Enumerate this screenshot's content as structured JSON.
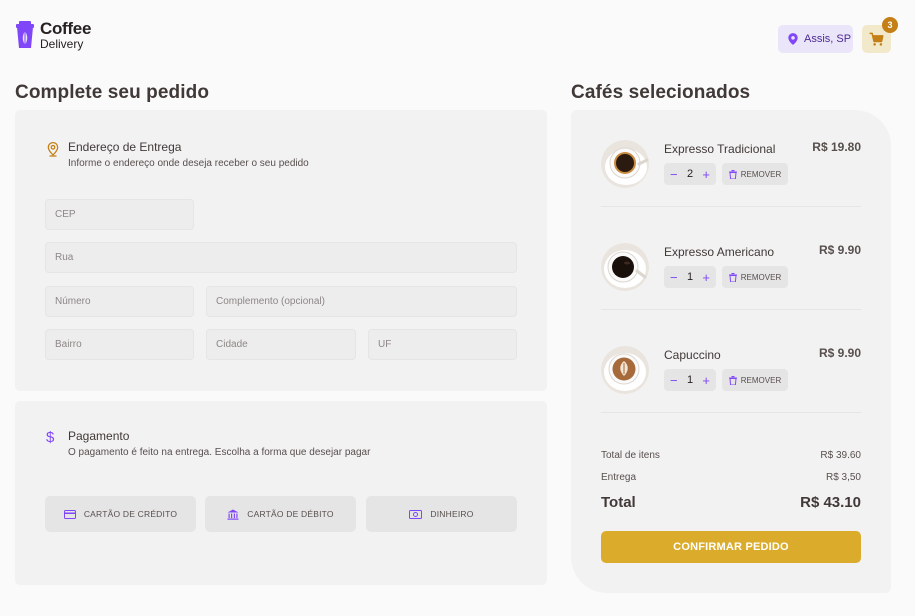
{
  "header": {
    "logo_line1": "Coffee",
    "logo_line2": "Delivery",
    "location": "Assis, SP",
    "cart_count": "3",
    "icons": {
      "location": "map-pin-icon",
      "cart": "shopping-cart-icon"
    }
  },
  "order": {
    "title": "Complete seu pedido",
    "address": {
      "title": "Endereço de Entrega",
      "subtitle": "Informe o endereço onde deseja receber o seu pedido",
      "icon": "map-pin-line-icon",
      "fields": {
        "cep": "CEP",
        "rua": "Rua",
        "numero": "Número",
        "complemento": "Complemento (opcional)",
        "bairro": "Bairro",
        "cidade": "Cidade",
        "uf": "UF"
      }
    },
    "payment": {
      "title": "Pagamento",
      "subtitle": "O pagamento é feito na entrega. Escolha a forma que desejar pagar",
      "icon": "currency-dollar-icon",
      "options": [
        "CARTÃO DE CRÉDITO",
        "CARTÃO DE DÉBITO",
        "DINHEIRO"
      ]
    }
  },
  "cart": {
    "title": "Cafés selecionados",
    "items": [
      {
        "name": "Expresso Tradicional",
        "price": "R$ 19.80",
        "qty": "2",
        "remove": "REMOVER"
      },
      {
        "name": "Expresso Americano",
        "price": "R$ 9.90",
        "qty": "1",
        "remove": "REMOVER"
      },
      {
        "name": "Capuccino",
        "price": "R$ 9.90",
        "qty": "1",
        "remove": "REMOVER"
      }
    ],
    "totals": {
      "items_label": "Total de itens",
      "items_value": "R$ 39.60",
      "delivery_label": "Entrega",
      "delivery_value": "R$ 3,50",
      "total_label": "Total",
      "total_value": "R$ 43.10"
    },
    "confirm_label": "CONFIRMAR PEDIDO"
  },
  "colors": {
    "purple": "#8047f8",
    "purple_dark": "#4b2995",
    "yellow": "#dbac2c",
    "yellow_dark": "#c47f17",
    "background": "#fafafa",
    "card": "#f3f2f2"
  }
}
